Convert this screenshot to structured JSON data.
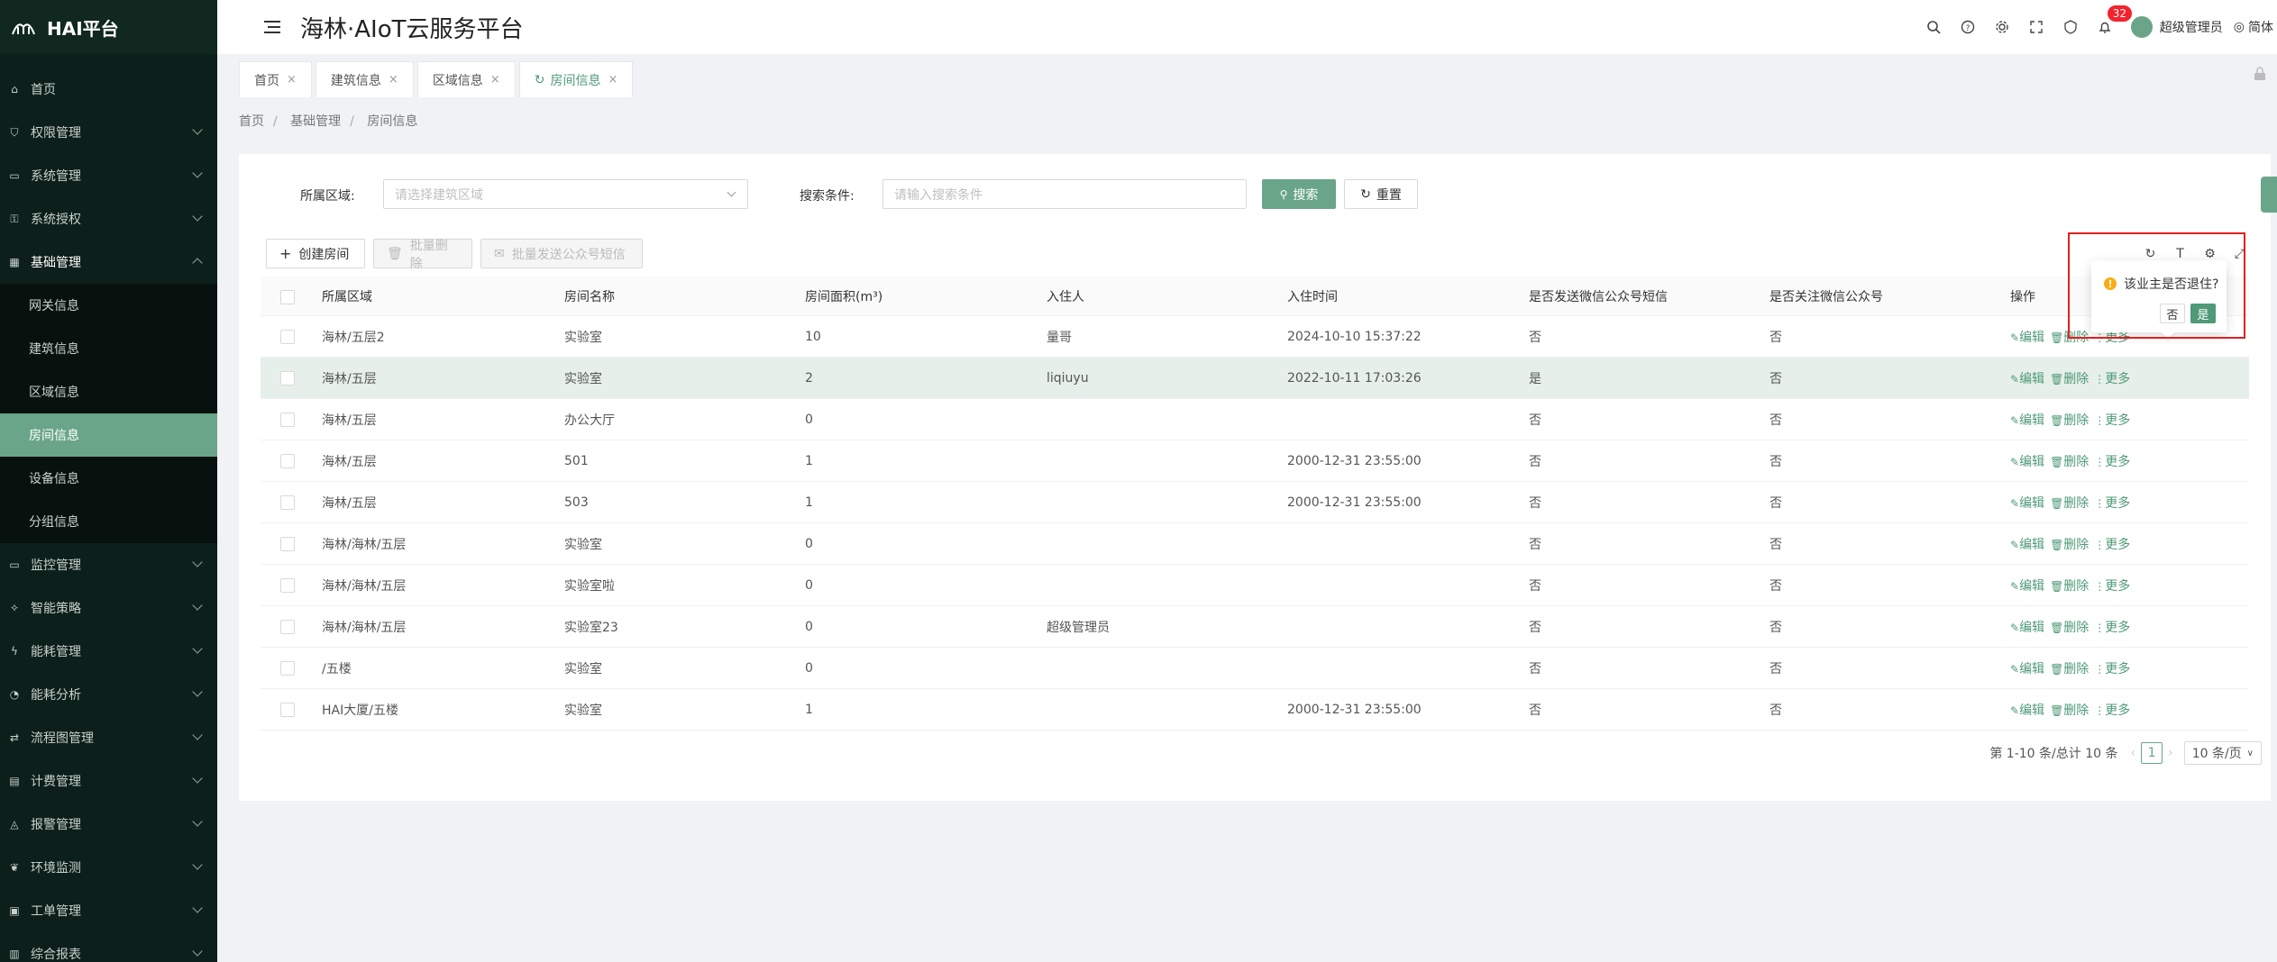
{
  "app": {
    "logo_text": "HAI平台",
    "title": "海林·AIoT云服务平台"
  },
  "header": {
    "notification_count": "32",
    "user_name": "超级管理员",
    "language": "简体"
  },
  "sidebar": {
    "items": [
      {
        "label": "首页",
        "icon": "home-icon"
      },
      {
        "label": "权限管理",
        "icon": "shield-icon"
      },
      {
        "label": "系统管理",
        "icon": "monitor-icon"
      },
      {
        "label": "系统授权",
        "icon": "key-icon"
      },
      {
        "label": "基础管理",
        "icon": "grid-icon"
      }
    ],
    "sub_items": [
      {
        "label": "网关信息"
      },
      {
        "label": "建筑信息"
      },
      {
        "label": "区域信息"
      },
      {
        "label": "房间信息"
      },
      {
        "label": "设备信息"
      },
      {
        "label": "分组信息"
      }
    ],
    "items_after": [
      {
        "label": "监控管理",
        "icon": "monitor-icon"
      },
      {
        "label": "智能策略",
        "icon": "bulb-icon"
      },
      {
        "label": "能耗管理",
        "icon": "energy-icon"
      },
      {
        "label": "能耗分析",
        "icon": "chart-icon"
      },
      {
        "label": "流程图管理",
        "icon": "flow-icon"
      },
      {
        "label": "计费管理",
        "icon": "bill-icon"
      },
      {
        "label": "报警管理",
        "icon": "alarm-icon"
      },
      {
        "label": "环境监测",
        "icon": "leaf-icon"
      },
      {
        "label": "工单管理",
        "icon": "ticket-icon"
      },
      {
        "label": "综合报表",
        "icon": "report-icon"
      }
    ]
  },
  "tabs": [
    {
      "label": "首页"
    },
    {
      "label": "建筑信息"
    },
    {
      "label": "区域信息"
    },
    {
      "label": "房间信息"
    }
  ],
  "breadcrumb": [
    "首页",
    "基础管理",
    "房间信息"
  ],
  "search": {
    "area_label": "所属区域:",
    "area_placeholder": "请选择建筑区域",
    "cond_label": "搜索条件:",
    "cond_placeholder": "请输入搜索条件",
    "search_btn": "搜索",
    "reset_btn": "重置"
  },
  "toolbar": {
    "create": "创建房间",
    "batch_delete": "批量删除",
    "batch_sms": "批量发送公众号短信"
  },
  "table": {
    "headers": [
      "所属区域",
      "房间名称",
      "房间面积(m³)",
      "入住人",
      "入住时间",
      "是否发送微信公众号短信",
      "是否关注微信公众号",
      "操作"
    ],
    "rows": [
      [
        "海林/五层2",
        "实验室",
        "10",
        "量哥",
        "2024-10-10 15:37:22",
        "否",
        "否"
      ],
      [
        "海林/五层",
        "实验室",
        "2",
        "liqiuyu",
        "2022-10-11 17:03:26",
        "是",
        "否"
      ],
      [
        "海林/五层",
        "办公大厅",
        "0",
        "",
        "",
        "否",
        "否"
      ],
      [
        "海林/五层",
        "501",
        "1",
        "",
        "2000-12-31 23:55:00",
        "否",
        "否"
      ],
      [
        "海林/五层",
        "503",
        "1",
        "",
        "2000-12-31 23:55:00",
        "否",
        "否"
      ],
      [
        "海林/海林/五层",
        "实验室",
        "0",
        "",
        "",
        "否",
        "否"
      ],
      [
        "海林/海林/五层",
        "实验室啦",
        "0",
        "",
        "",
        "否",
        "否"
      ],
      [
        "海林/海林/五层",
        "实验室23",
        "0",
        "超级管理员",
        "",
        "否",
        "否"
      ],
      [
        "/五楼",
        "实验室",
        "0",
        "",
        "",
        "否",
        "否"
      ],
      [
        "HAI大厦/五楼",
        "实验室",
        "1",
        "",
        "2000-12-31 23:55:00",
        "否",
        "否"
      ]
    ],
    "actions": {
      "edit": "编辑",
      "delete": "删除",
      "more": "更多"
    }
  },
  "pagination": {
    "summary": "第 1-10 条/总计 10 条",
    "page": "1",
    "page_size": "10 条/页"
  },
  "popconfirm": {
    "message": "该业主是否退住?",
    "no": "否",
    "yes": "是"
  },
  "colors": {
    "accent": "#6aa589",
    "sidebar_bg": "#0d1f1a",
    "highlight_box": "#e02020"
  }
}
